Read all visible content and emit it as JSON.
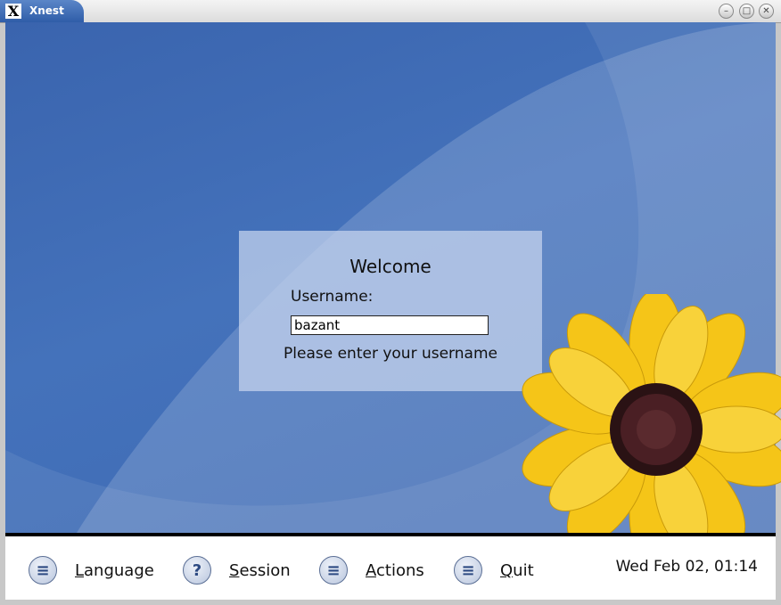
{
  "window": {
    "title": "Xnest",
    "logo": "X"
  },
  "login": {
    "welcome": "Welcome",
    "username_label": "Username:",
    "username_value": "bazant",
    "status": "Please enter your username"
  },
  "taskbar": {
    "language": {
      "mnemonic": "L",
      "rest": "anguage",
      "icon": "menu-icon"
    },
    "session": {
      "mnemonic": "S",
      "rest": "ession",
      "icon": "help-icon"
    },
    "actions": {
      "mnemonic": "A",
      "rest": "ctions",
      "icon": "menu-icon"
    },
    "quit": {
      "mnemonic": "Q",
      "rest": "uit",
      "icon": "menu-icon"
    },
    "clock": "Wed Feb 02, 01:14"
  },
  "colors": {
    "desktop": "#4472bb",
    "flower_petal": "#f5c518",
    "flower_center": "#3a1a1e"
  }
}
